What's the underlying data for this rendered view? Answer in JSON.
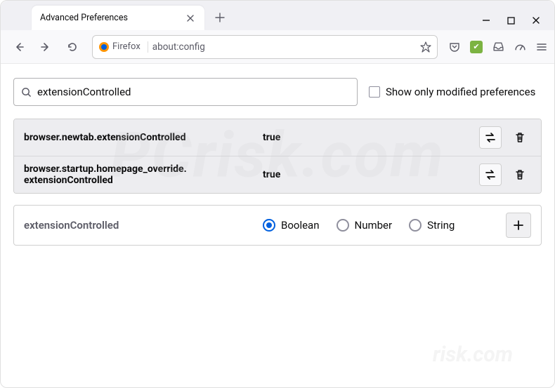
{
  "titlebar": {
    "tab_title": "Advanced Preferences"
  },
  "urlbar": {
    "identity_label": "Firefox",
    "url": "about:config"
  },
  "search": {
    "value": "extensionControlled",
    "checkbox_label": "Show only modified preferences"
  },
  "prefs": [
    {
      "name": "browser.newtab.extensionControlled",
      "value": "true"
    },
    {
      "name": "browser.startup.homepage_override.extensionControlled",
      "value": "true"
    }
  ],
  "new_pref": {
    "name": "extensionControlled",
    "options": [
      "Boolean",
      "Number",
      "String"
    ],
    "selected": 0
  },
  "watermark": "PCrisk.com",
  "watermark2": "risk.com"
}
